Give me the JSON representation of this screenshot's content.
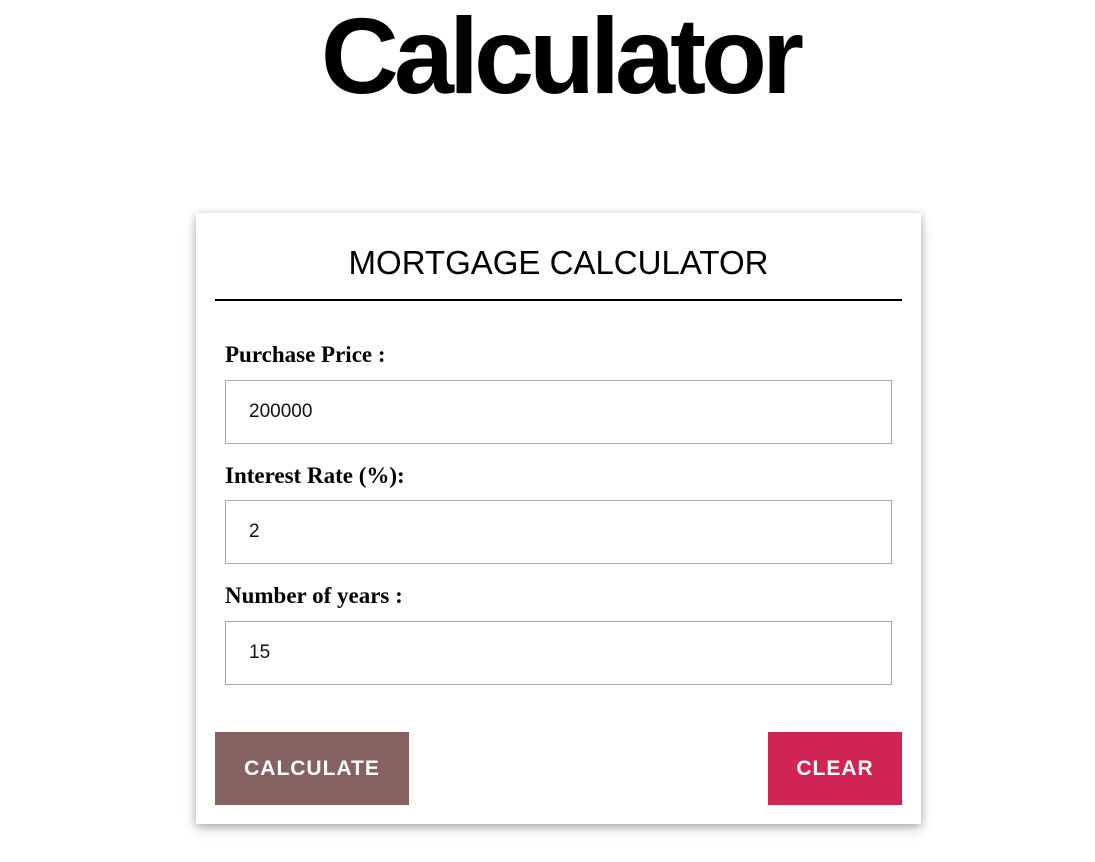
{
  "page": {
    "title": "Calculator"
  },
  "calculator": {
    "title": "MORTGAGE CALCULATOR",
    "fields": [
      {
        "label": "Purchase Price :",
        "value": "200000"
      },
      {
        "label": "Interest Rate (%):",
        "value": "2"
      },
      {
        "label": "Number of years :",
        "value": "15"
      }
    ],
    "buttons": {
      "calculate_label": "CALCULATE",
      "clear_label": "CLEAR"
    }
  },
  "colors": {
    "calculate_button": "#85625f",
    "clear_button": "#d02454",
    "input_border": "#a7a7a7",
    "header_rule": "#000000"
  }
}
